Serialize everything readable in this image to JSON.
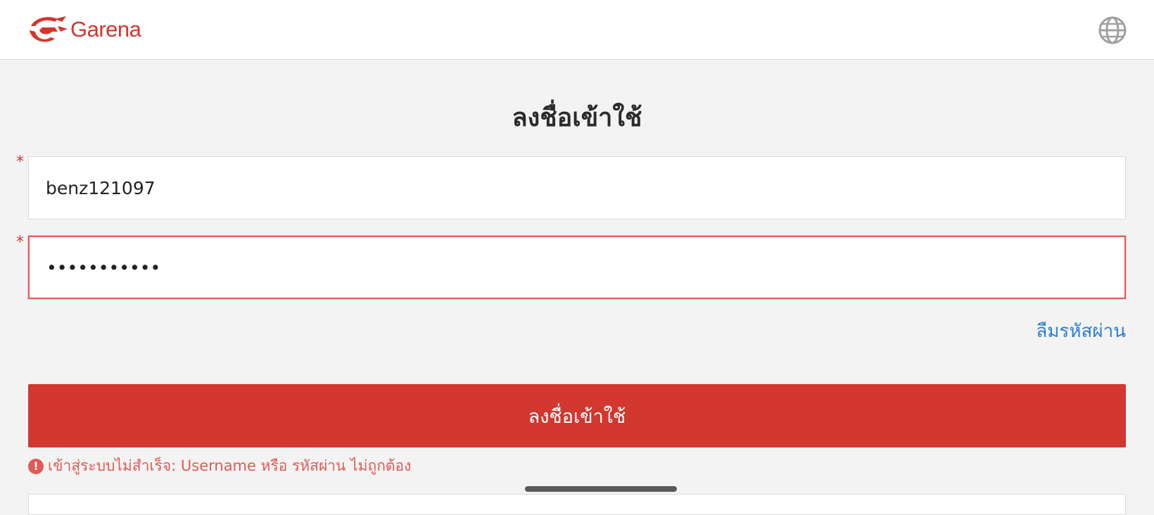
{
  "header": {
    "brand": "Garena",
    "logo_icon": "garena-dragon-logo",
    "language_icon": "globe-icon"
  },
  "login": {
    "title": "ลงชื่อเข้าใช้",
    "required_mark": "*",
    "username_value": "benz121097",
    "password_value": "•••••••••••",
    "forgot_password": "ลืมรหัสผ่าน",
    "submit_label": "ลงชื่อเข้าใช้",
    "error_message": "เข้าสู่ระบบไม่สำเร็จ: Username หรือ รหัสผ่าน ไม่ถูกต้อง",
    "error_icon": "!"
  },
  "colors": {
    "brand_red": "#d23730",
    "link_blue": "#2a7fd4",
    "error_red": "#e05a55"
  }
}
